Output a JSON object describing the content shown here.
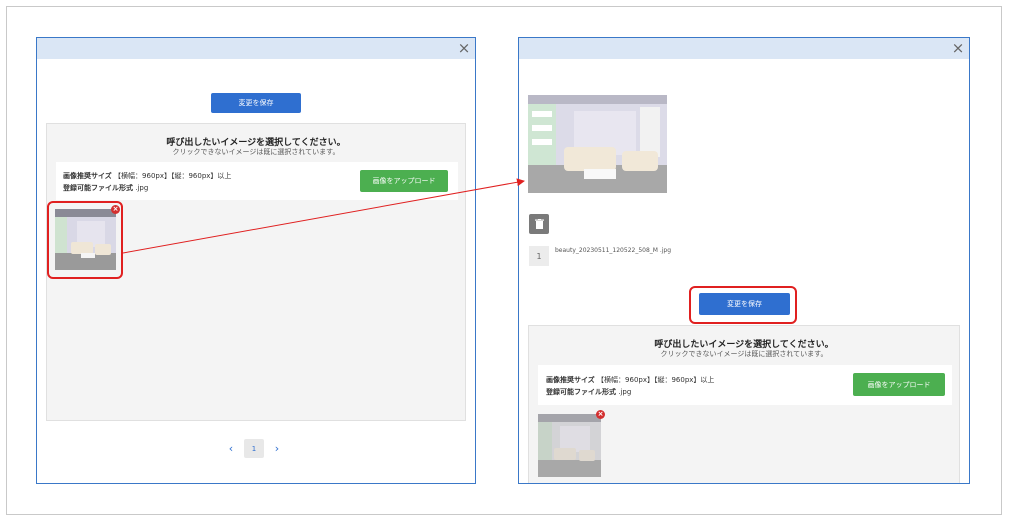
{
  "dialogs": {
    "close_glyph": "×",
    "save_label": "変更を保存",
    "panel_title": "呼び出したいイメージを選択してください。",
    "panel_subtitle": "クリックできないイメージは既に選択されています。",
    "size_label": "画像推奨サイズ",
    "size_value": "【横幅：960px】【縦：960px】以上",
    "format_label": "登録可能ファイル形式",
    "format_value": ".jpg",
    "upload_label": "画像をアップロード",
    "remove_glyph": "×"
  },
  "pager": {
    "prev": "‹",
    "page": "1",
    "next": "›"
  },
  "file": {
    "index": "1",
    "name": "beauty_20230511_120522_508_M .jpg"
  },
  "colors": {
    "accent": "#2f6fd0",
    "upload": "#4caf50",
    "highlight": "#e02020"
  }
}
